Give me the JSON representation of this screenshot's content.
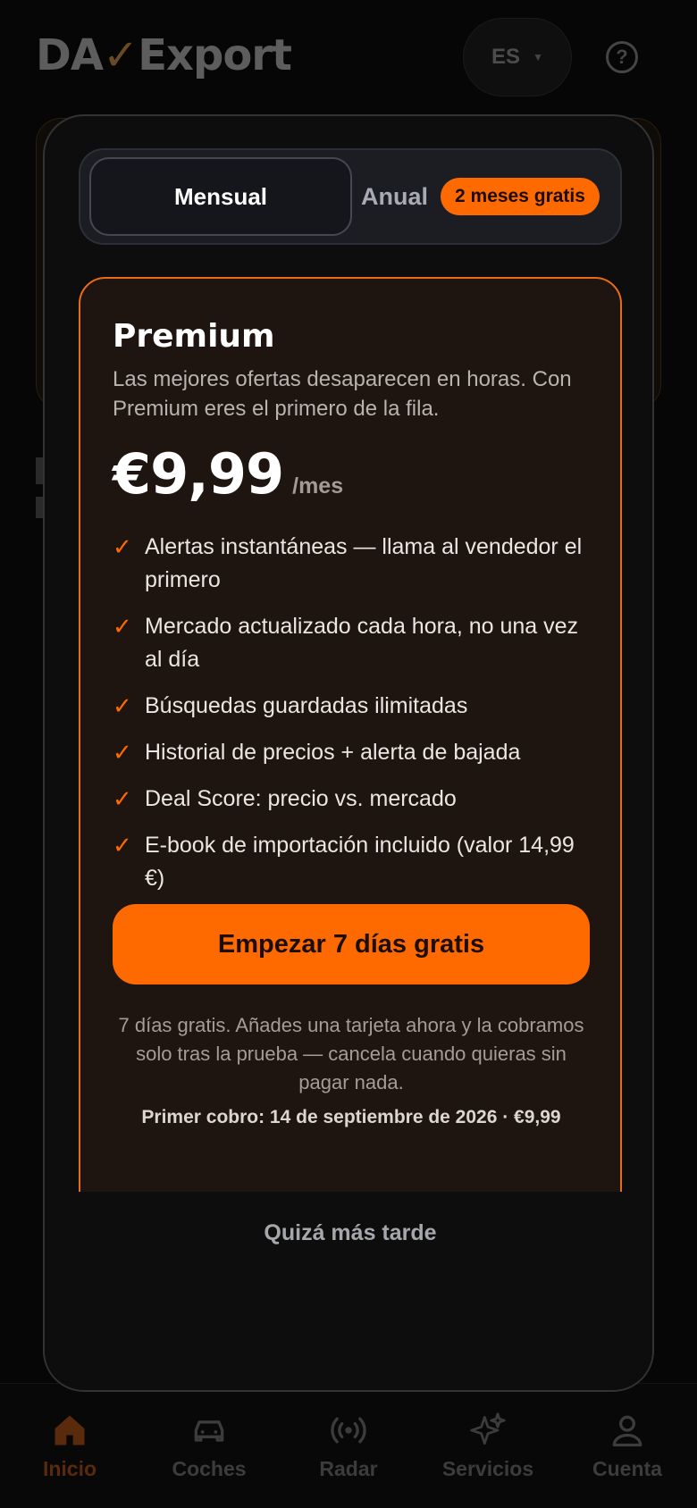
{
  "header": {
    "logo_da": "DA",
    "logo_mark": "✓",
    "logo_export": "Export",
    "language": "ES"
  },
  "modal": {
    "billing_toggle": {
      "monthly_label": "Mensual",
      "annual_label": "Anual",
      "annual_badge": "2 meses gratis",
      "selected": "Mensual"
    },
    "plan": {
      "name": "Premium",
      "description": "Las mejores ofertas desaparecen en horas. Con Premium eres el primero de la fila.",
      "price": "€9,99",
      "period": "/mes",
      "features": [
        "Alertas instantáneas — llama al vendedor el primero",
        "Mercado actualizado cada hora, no una vez al día",
        "Búsquedas guardadas ilimitadas",
        "Historial de precios + alerta de bajada",
        "Deal Score: precio vs. mercado",
        "E-book de importación incluido (valor 14,99 €)"
      ],
      "cta_label": "Empezar 7 días gratis",
      "trial_note": "7 días gratis. Añades una tarjeta ahora y la cobramos solo tras la prueba — cancela cuando quieras sin pagar nada.",
      "first_charge": "Primer cobro: 14 de septiembre de 2026 · €9,99"
    },
    "dismiss_label": "Quizá más tarde"
  },
  "bottom_nav": {
    "items": [
      {
        "label": "Inicio",
        "icon": "home-icon",
        "active": true
      },
      {
        "label": "Coches",
        "icon": "car-icon",
        "active": false
      },
      {
        "label": "Radar",
        "icon": "radar-icon",
        "active": false
      },
      {
        "label": "Servicios",
        "icon": "sparkles-icon",
        "active": false
      },
      {
        "label": "Cuenta",
        "icon": "user-icon",
        "active": false
      }
    ]
  },
  "colors": {
    "accent": "#ff6a00",
    "card_bg": "#1e1410",
    "modal_bg": "#0d0d0d"
  }
}
